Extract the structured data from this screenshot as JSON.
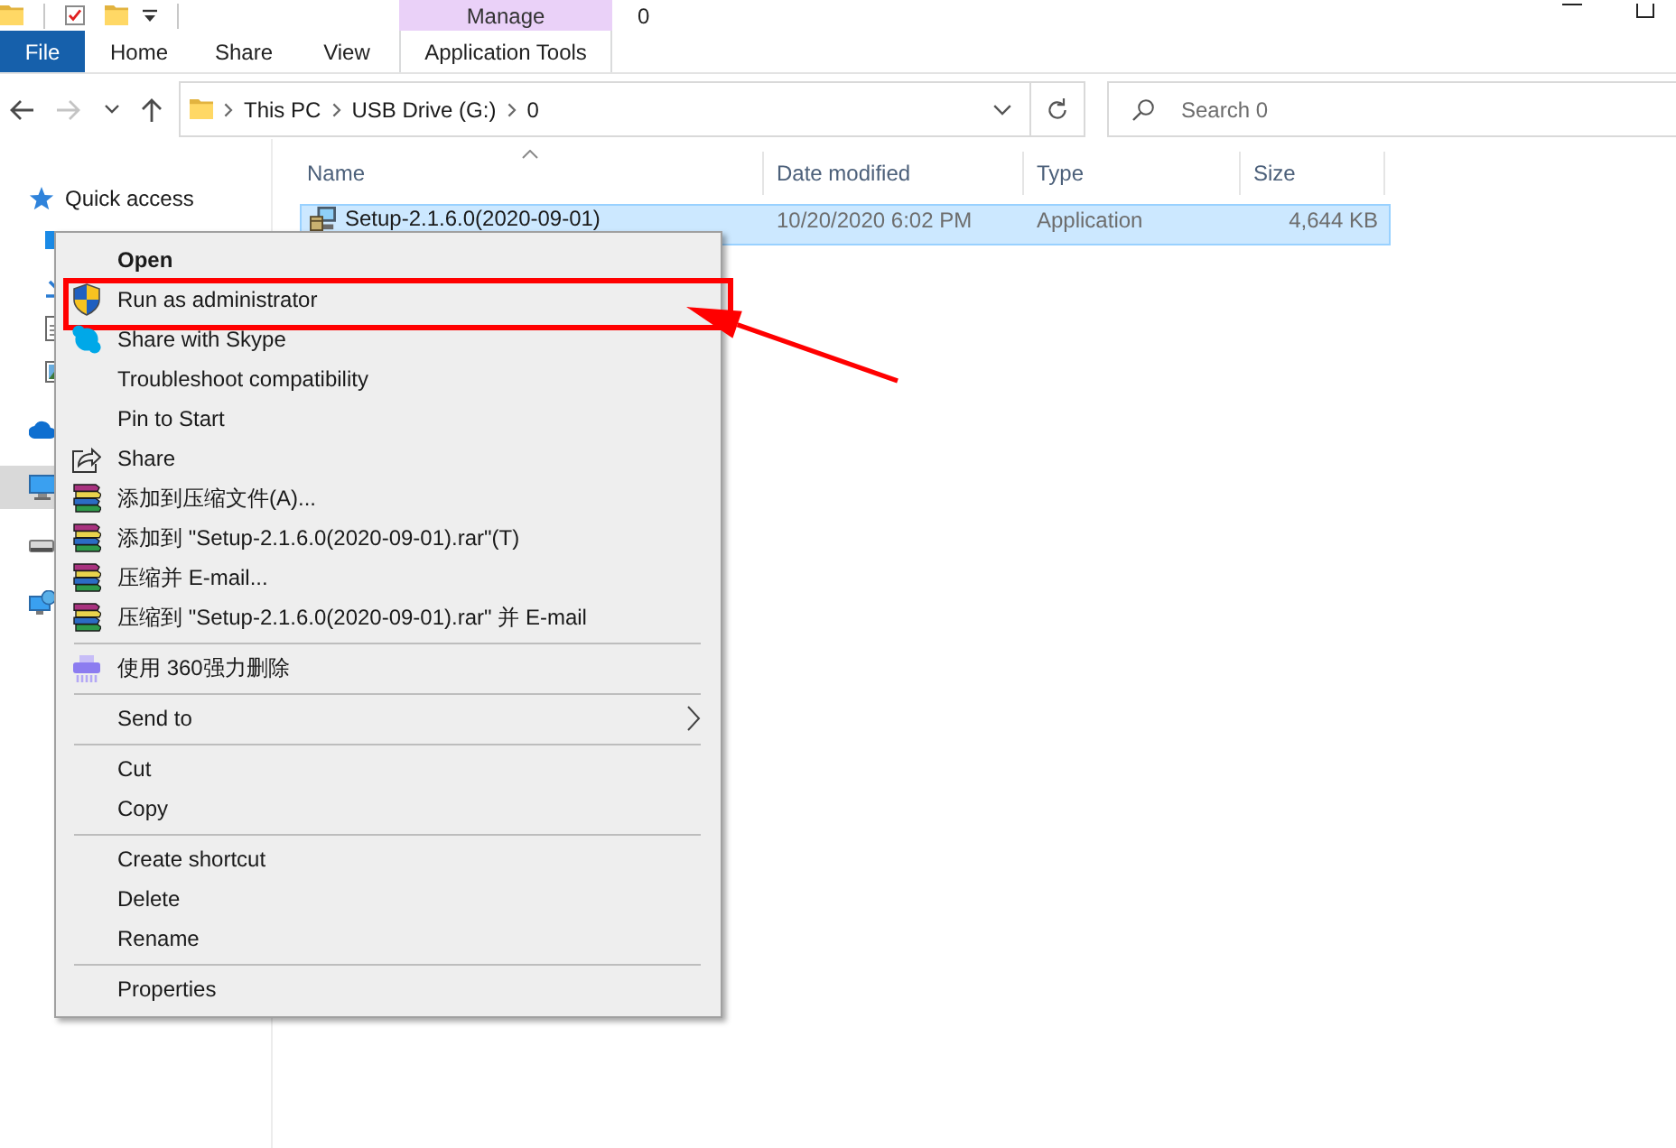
{
  "title_bar": {
    "title": "0",
    "contextual_header": "Manage"
  },
  "ribbon": {
    "tabs": [
      {
        "label": "File",
        "kind": "file"
      },
      {
        "label": "Home",
        "kind": "tab"
      },
      {
        "label": "Share",
        "kind": "tab"
      },
      {
        "label": "View",
        "kind": "tab"
      },
      {
        "label": "Application Tools",
        "kind": "contextual"
      }
    ]
  },
  "nav_buttons": [
    {
      "kind": "back",
      "disabled": false
    },
    {
      "kind": "forward",
      "disabled": true
    },
    {
      "kind": "recent",
      "disabled": false
    },
    {
      "kind": "up",
      "disabled": false
    }
  ],
  "address_bar": {
    "path": [
      "This PC",
      "USB Drive (G:)",
      "0"
    ]
  },
  "search": {
    "placeholder": "Search 0"
  },
  "navigation": {
    "items": [
      {
        "kind": "star",
        "label": "Quick access",
        "selected": false,
        "children": [
          {
            "kind": "desktop",
            "selected": false
          },
          {
            "kind": "download",
            "selected": false
          },
          {
            "kind": "document",
            "selected": false
          },
          {
            "kind": "pictures",
            "selected": false
          }
        ]
      },
      {
        "kind": "cloud",
        "selected": false
      },
      {
        "kind": "computer",
        "selected": true
      },
      {
        "kind": "drive",
        "selected": false
      },
      {
        "kind": "network",
        "selected": false
      }
    ]
  },
  "table": {
    "columns": [
      {
        "label": "Name",
        "sorted": true
      },
      {
        "label": "Date modified",
        "sorted": false
      },
      {
        "label": "Type",
        "sorted": false
      },
      {
        "label": "Size",
        "sorted": false
      }
    ],
    "rows": [
      {
        "selected": true,
        "cells": [
          "Setup-2.1.6.0(2020-09-01)",
          "10/20/2020 6:02 PM",
          "Application",
          "4,644 KB"
        ]
      }
    ]
  },
  "context_menu": {
    "items": [
      {
        "kind": "plain",
        "label": "Open",
        "default": true,
        "highlighted": false
      },
      {
        "kind": "shield",
        "label": "Run as administrator",
        "default": false,
        "highlighted": true
      },
      {
        "kind": "chat",
        "label": "Share with Skype",
        "default": false,
        "highlighted": false
      },
      {
        "kind": "plain",
        "label": "Troubleshoot compatibility",
        "default": false,
        "highlighted": false
      },
      {
        "kind": "plain",
        "label": "Pin to Start",
        "default": false,
        "highlighted": false
      },
      {
        "kind": "share",
        "label": "Share",
        "default": false,
        "highlighted": false
      },
      {
        "kind": "archive",
        "label": "添加到压缩文件(A)...",
        "default": false,
        "highlighted": false
      },
      {
        "kind": "archive",
        "label": "添加到 \"Setup-2.1.6.0(2020-09-01).rar\"(T)",
        "default": false,
        "highlighted": false
      },
      {
        "kind": "archive",
        "label": "压缩并 E-mail...",
        "default": false,
        "highlighted": false
      },
      {
        "kind": "archive",
        "label": "压缩到 \"Setup-2.1.6.0(2020-09-01).rar\" 并 E-mail",
        "default": false,
        "highlighted": false
      },
      {
        "kind": "separator"
      },
      {
        "kind": "shredder",
        "label": "使用 360强力删除",
        "default": false,
        "highlighted": false
      },
      {
        "kind": "separator"
      },
      {
        "kind": "submenu",
        "label": "Send to",
        "default": false,
        "highlighted": false
      },
      {
        "kind": "separator"
      },
      {
        "kind": "plain",
        "label": "Cut",
        "default": false,
        "highlighted": false
      },
      {
        "kind": "plain",
        "label": "Copy",
        "default": false,
        "highlighted": false
      },
      {
        "kind": "separator"
      },
      {
        "kind": "plain",
        "label": "Create shortcut",
        "default": false,
        "highlighted": false
      },
      {
        "kind": "plain",
        "label": "Delete",
        "default": false,
        "highlighted": false
      },
      {
        "kind": "plain",
        "label": "Rename",
        "default": false,
        "highlighted": false
      },
      {
        "kind": "separator"
      },
      {
        "kind": "plain",
        "label": "Properties",
        "default": false,
        "highlighted": false
      }
    ]
  }
}
